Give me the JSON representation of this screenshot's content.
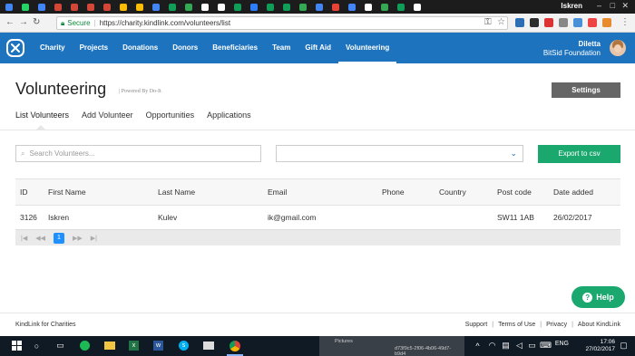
{
  "browser": {
    "profile_name": "Iskren",
    "secure_label": "Secure",
    "url": "https://charity.kindlink.com/volunteers/list",
    "tab_favicons": [
      "#4285f4",
      "#25d366",
      "#4285f4",
      "#d44638",
      "#d44638",
      "#d44638",
      "#d44638",
      "#fbbc05",
      "#fbbc05",
      "#4285f4",
      "#0f9d58",
      "#34a853",
      "#ffffff",
      "#ffffff",
      "#0f9d58",
      "#2d7ff9",
      "#0f9d58",
      "#0f9d58",
      "#34a853",
      "#4285f4",
      "#ea4335",
      "#4285f4",
      "#ffffff",
      "#34a853",
      "#0f9d58",
      "#ffffff"
    ]
  },
  "nav": {
    "items": [
      "Charity",
      "Projects",
      "Donations",
      "Donors",
      "Beneficiaries",
      "Team",
      "Gift Aid",
      "Volunteering"
    ],
    "active": "Volunteering",
    "user_name": "Diletta",
    "org_name": "BitSid Foundation"
  },
  "page": {
    "title": "Volunteering",
    "powered_by": "| Powered By Do-It",
    "settings_label": "Settings",
    "tabs": [
      "List Volunteers",
      "Add Volunteer",
      "Opportunities",
      "Applications"
    ]
  },
  "filters": {
    "search_placeholder": "Search Volunteers...",
    "select_value": "",
    "export_label": "Export to csv"
  },
  "table": {
    "columns": [
      "ID",
      "First Name",
      "Last Name",
      "Email",
      "Phone",
      "Country",
      "Post code",
      "Date added"
    ],
    "rows": [
      [
        "3126",
        "Iskren",
        "Kulev",
        "ik@gmail.com",
        "",
        "",
        "SW11 1AB",
        "26/02/2017"
      ]
    ],
    "current_page": "1"
  },
  "help_label": "Help",
  "footer": {
    "left": "KindLink for Charities",
    "links": [
      "Support",
      "Terms of Use",
      "Privacy",
      "About KindLink"
    ]
  },
  "taskbar": {
    "preview_title": "Pictures",
    "preview_text": "d73f9c5-2f06-4b06-49d7-b9d4",
    "language": "ENG",
    "time": "17:06",
    "date": "27/02/2017"
  },
  "colors": {
    "nav_bg": "#1e73be",
    "export_bg": "#1aa86f",
    "settings_bg": "#666666"
  }
}
